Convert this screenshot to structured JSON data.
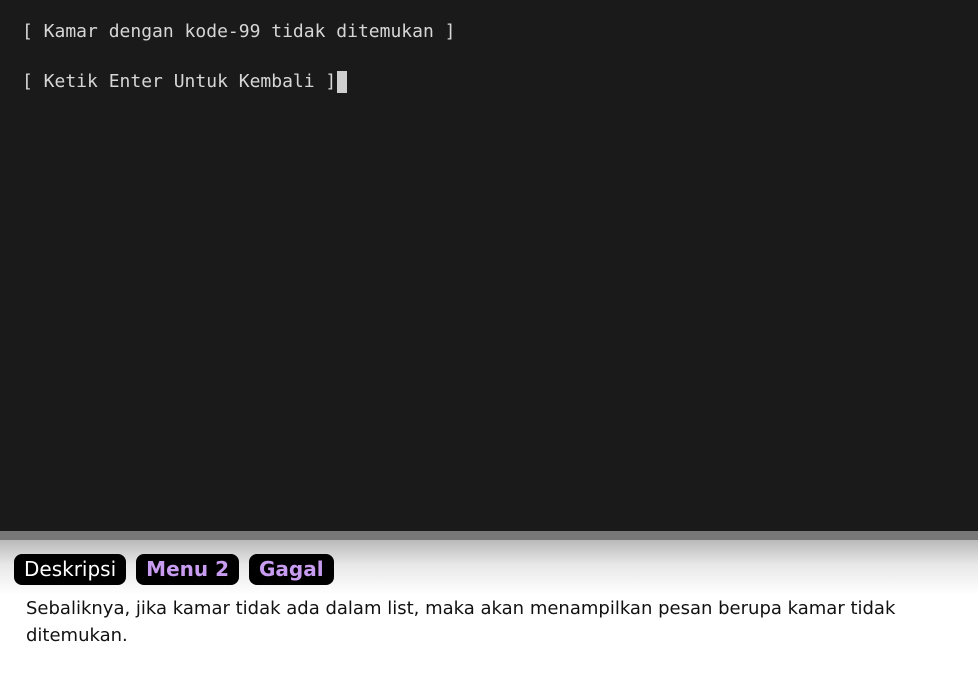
{
  "terminal": {
    "lines": [
      "[ Kamar dengan kode-99 tidak ditemukan ]",
      "[ Ketik Enter Untuk Kembali ]"
    ],
    "background": "#1a1a1a",
    "text_color": "#d6d6d6"
  },
  "badges": {
    "description": "Deskripsi",
    "menu": "Menu 2",
    "status": "Gagal",
    "accent_color": "#c89cf0"
  },
  "description": {
    "text": "Sebaliknya, jika kamar tidak ada dalam list, maka akan menampilkan pesan berupa kamar tidak ditemukan."
  }
}
